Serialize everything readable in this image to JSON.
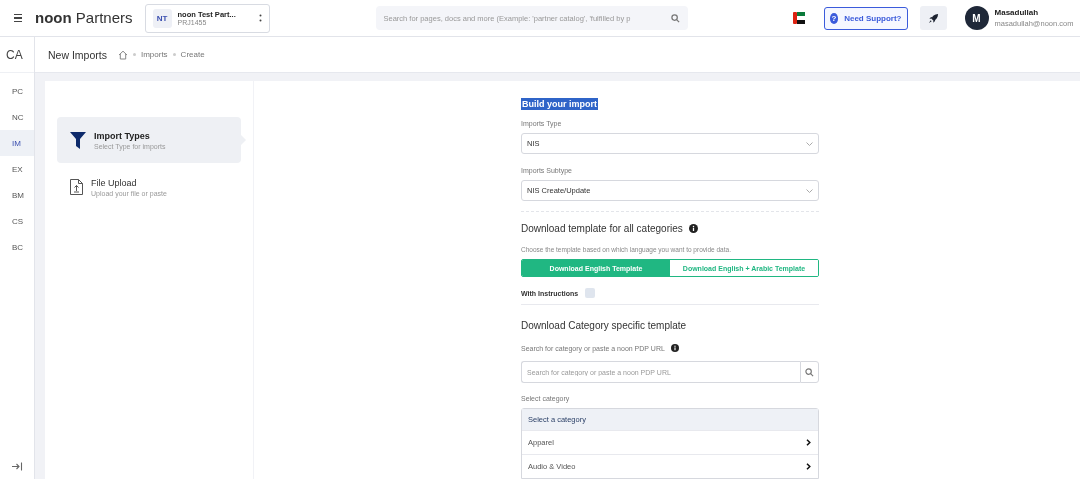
{
  "header": {
    "brand_bold": "noon",
    "brand_light": "Partners",
    "partner": {
      "initials": "NT",
      "name": "noon Test Part...",
      "id": "PRJ1455"
    },
    "search": {
      "placeholder": "Search for pages, docs and more (Example: 'partner catalog', 'fulfilled by p"
    },
    "support": "Need Support?",
    "support_icon": "?",
    "user": {
      "initial": "M",
      "name": "Masadullah",
      "email": "masadullah@noon.com"
    }
  },
  "rail": {
    "top": "CA",
    "items": [
      {
        "label": "PC",
        "selected": false
      },
      {
        "label": "NC",
        "selected": false
      },
      {
        "label": "IM",
        "selected": true
      },
      {
        "label": "EX",
        "selected": false
      },
      {
        "label": "BM",
        "selected": false
      },
      {
        "label": "CS",
        "selected": false
      },
      {
        "label": "BC",
        "selected": false
      }
    ]
  },
  "page": {
    "title": "New Imports",
    "breadcrumbs": [
      "Imports",
      "Create"
    ]
  },
  "steps": [
    {
      "kind": "filter",
      "title": "Import Types",
      "subtitle": "Select Type for imports",
      "selected": true
    },
    {
      "kind": "upload",
      "title": "File Upload",
      "subtitle": "Upload your file or paste",
      "selected": false
    }
  ],
  "form": {
    "heading": "Build your import",
    "imports_type": {
      "label": "Imports Type",
      "value": "NIS"
    },
    "imports_subtype": {
      "label": "Imports Subtype",
      "value": "NIS Create/Update"
    },
    "all_categories": {
      "heading": "Download template for all categories",
      "hint": "Choose the template based on which language you want to provide data.",
      "templates": [
        {
          "label": "Download English Template",
          "selected": true
        },
        {
          "label": "Download English + Arabic Template",
          "selected": false
        }
      ],
      "with_instructions": {
        "label": "With Instructions",
        "checked": false
      }
    },
    "category_specific": {
      "heading": "Download Category specific template",
      "search_label": "Search for category or paste a noon PDP URL",
      "search_placeholder": "Search for category or paste a noon PDP URL",
      "select_label": "Select category",
      "list_header": "Select a category",
      "categories": [
        "Apparel",
        "Audio & Video"
      ]
    }
  }
}
